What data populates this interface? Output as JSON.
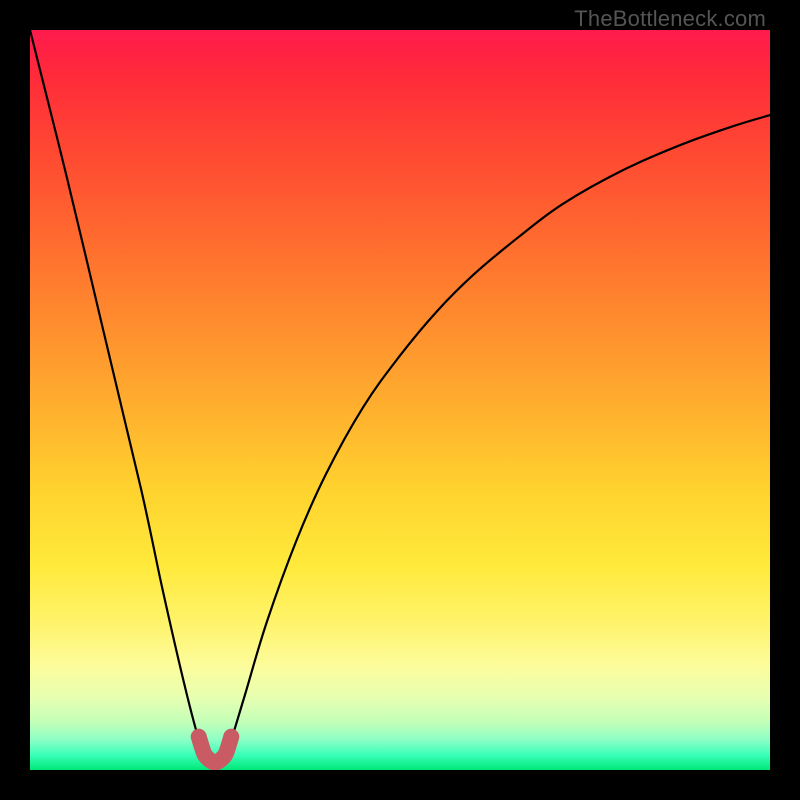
{
  "watermark": "TheBottleneck.com",
  "chart_data": {
    "type": "line",
    "title": "",
    "xlabel": "",
    "ylabel": "",
    "xlim": [
      0,
      100
    ],
    "ylim": [
      0,
      100
    ],
    "series": [
      {
        "name": "curve",
        "x": [
          0,
          5,
          10,
          15,
          18,
          21,
          23,
          24,
          25,
          26,
          27,
          29,
          32,
          36,
          40,
          45,
          50,
          55,
          60,
          66,
          72,
          80,
          88,
          95,
          100
        ],
        "values": [
          100,
          80,
          59,
          38,
          24,
          11,
          3.5,
          1.5,
          1.0,
          1.5,
          3.5,
          10,
          20,
          31,
          40,
          49,
          56,
          62,
          67,
          72,
          76.5,
          81,
          84.5,
          87,
          88.5
        ]
      },
      {
        "name": "bottom-marker",
        "x": [
          22.8,
          23.5,
          24,
          24.5,
          25,
          25.5,
          26,
          26.5,
          27.2
        ],
        "values": [
          4.5,
          2.3,
          1.6,
          1.2,
          1.0,
          1.2,
          1.6,
          2.3,
          4.5
        ]
      }
    ],
    "gradient": {
      "top": "#ff1a4d",
      "bottom": "#00e878",
      "stops": [
        "red",
        "orange",
        "yellow",
        "green"
      ]
    }
  }
}
